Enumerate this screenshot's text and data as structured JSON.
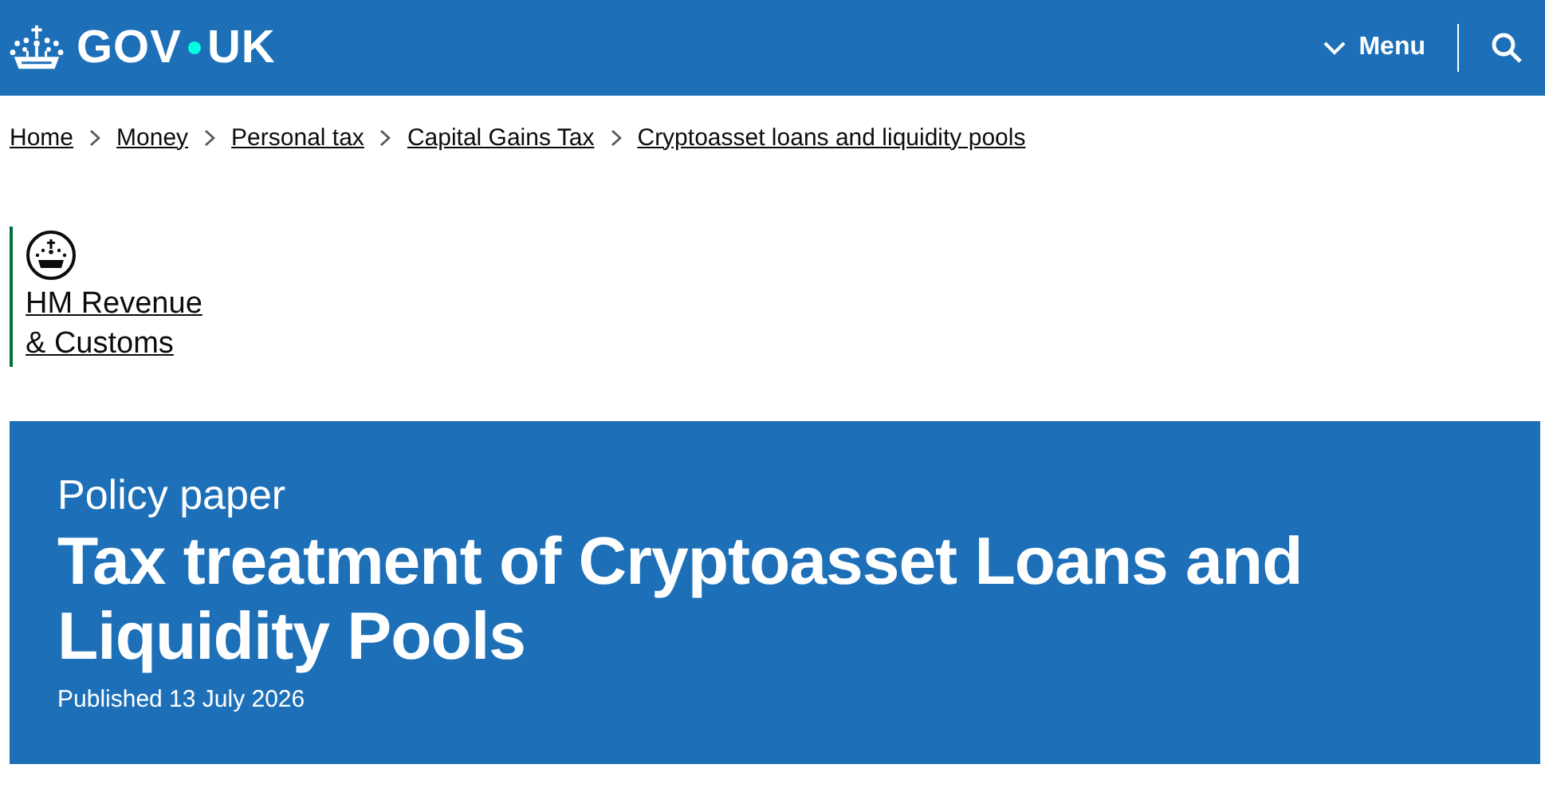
{
  "header": {
    "logo": {
      "left": "GOV",
      "right": "UK"
    },
    "menu_label": "Menu"
  },
  "breadcrumbs": [
    "Home",
    "Money",
    "Personal tax",
    "Capital Gains Tax",
    "Cryptoasset loans and liquidity pools"
  ],
  "organisation": {
    "lines": [
      "HM Revenue",
      "& Customs"
    ],
    "color": "#00703c"
  },
  "banner": {
    "type": "Policy paper",
    "title": "Tax treatment of Cryptoasset Loans and Liquidity Pools",
    "published": "Published 13 July 2026"
  }
}
